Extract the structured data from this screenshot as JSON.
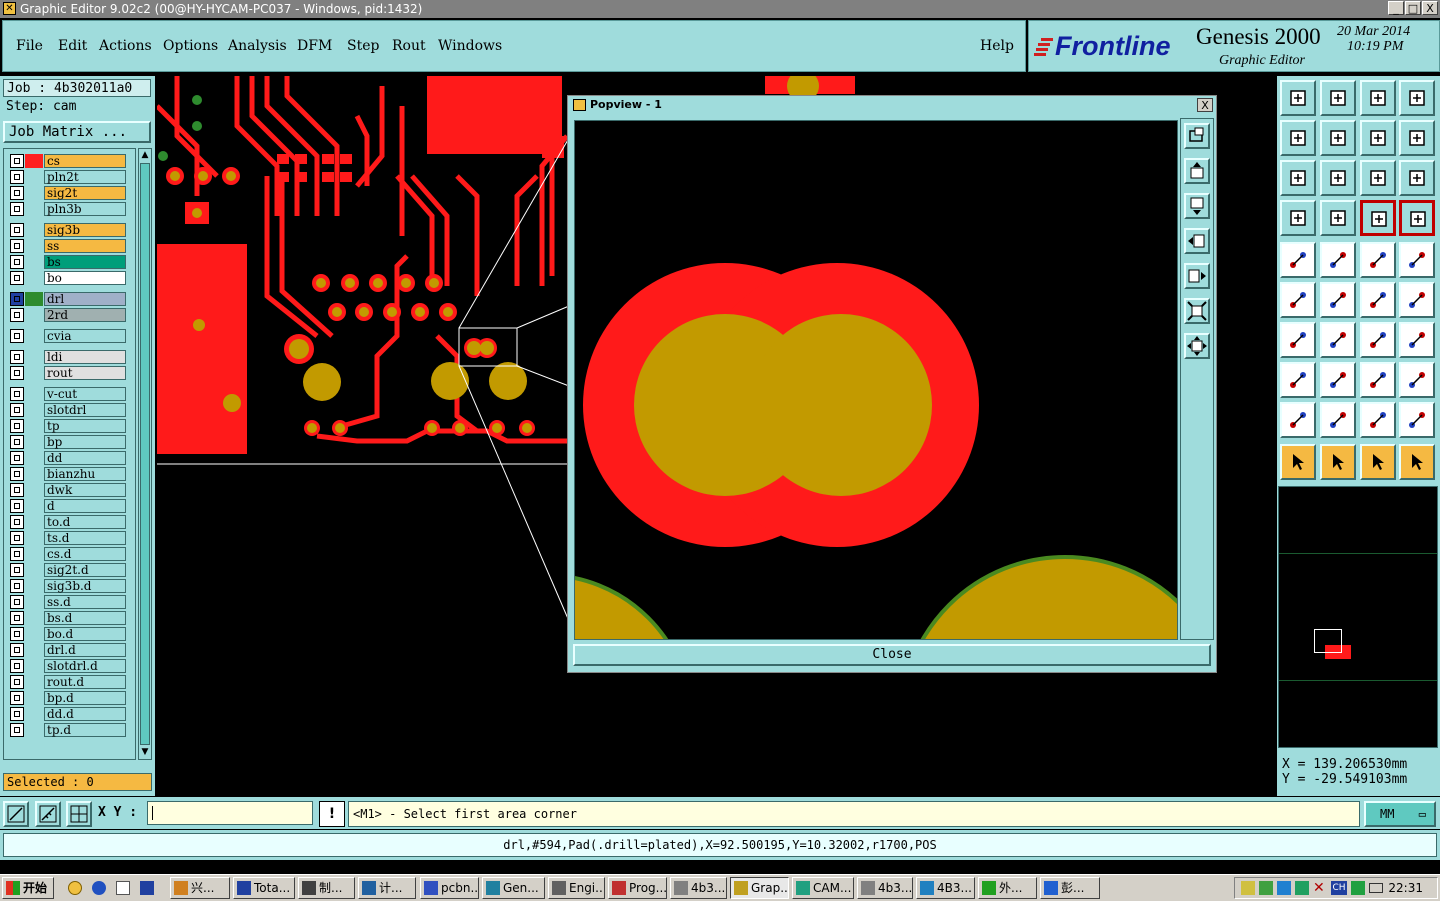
{
  "window": {
    "title": "Graphic Editor 9.02c2 (00@HY-HYCAM-PC037 - Windows, pid:1432)",
    "buttons": [
      "_",
      "□",
      "X"
    ]
  },
  "menu": {
    "items": [
      "File",
      "Edit",
      "Actions",
      "Options",
      "Analysis",
      "DFM",
      "Step",
      "Rout",
      "Windows"
    ],
    "help": "Help"
  },
  "brand": {
    "logo": "Frontline",
    "product": "Genesis 2000",
    "subtitle": "Graphic Editor",
    "date": "20 Mar 2014",
    "time": "10:19 PM"
  },
  "job": {
    "job_label": "Job : 4b302011a0",
    "step_label": "Step: cam",
    "matrix_button": "Job Matrix ..."
  },
  "layers": [
    {
      "name": "cs",
      "color": "#ff2020",
      "bg": "#f5b942",
      "gap": 0
    },
    {
      "name": "pln2t",
      "color": "",
      "bg": "#9fdcdc",
      "gap": 0
    },
    {
      "name": "sig2t",
      "color": "",
      "bg": "#f5b942",
      "gap": 0
    },
    {
      "name": "pln3b",
      "color": "",
      "bg": "#9fdcdc",
      "gap": 0
    },
    {
      "name": "sig3b",
      "color": "",
      "bg": "#f5b942",
      "gap": 1
    },
    {
      "name": "ss",
      "color": "",
      "bg": "#f5b942",
      "gap": 0
    },
    {
      "name": "bs",
      "color": "",
      "bg": "#009e7a",
      "gap": 0
    },
    {
      "name": "bo",
      "color": "",
      "bg": "#ffffff",
      "gap": 0,
      "mark": "✎"
    },
    {
      "name": "drl",
      "color": "#2e8b2e",
      "bg": "#a0b0c8",
      "gap": 1,
      "mark": "▦",
      "check_bg": "#2040a0"
    },
    {
      "name": "2rd",
      "color": "",
      "bg": "#a0b0b0",
      "gap": 0
    },
    {
      "name": "cvia",
      "color": "",
      "bg": "#9fdcdc",
      "gap": 1
    },
    {
      "name": "ldi",
      "color": "",
      "bg": "#e0e0e0",
      "gap": 1
    },
    {
      "name": "rout",
      "color": "",
      "bg": "#e0e0e0",
      "gap": 0
    },
    {
      "name": "v-cut",
      "color": "",
      "bg": "#9fdcdc",
      "gap": 1
    },
    {
      "name": "slotdrl",
      "color": "",
      "bg": "#9fdcdc",
      "gap": 0
    },
    {
      "name": "tp",
      "color": "",
      "bg": "#9fdcdc",
      "gap": 0
    },
    {
      "name": "bp",
      "color": "",
      "bg": "#9fdcdc",
      "gap": 0
    },
    {
      "name": "dd",
      "color": "",
      "bg": "#9fdcdc",
      "gap": 0
    },
    {
      "name": "bianzhu",
      "color": "",
      "bg": "#9fdcdc",
      "gap": 0
    },
    {
      "name": "dwk",
      "color": "",
      "bg": "#9fdcdc",
      "gap": 0
    },
    {
      "name": "d",
      "color": "",
      "bg": "#9fdcdc",
      "gap": 0
    },
    {
      "name": "to.d",
      "color": "",
      "bg": "#9fdcdc",
      "gap": 0,
      "mark": "✎"
    },
    {
      "name": "ts.d",
      "color": "",
      "bg": "#9fdcdc",
      "gap": 0
    },
    {
      "name": "cs.d",
      "color": "",
      "bg": "#9fdcdc",
      "gap": 0
    },
    {
      "name": "sig2t.d",
      "color": "",
      "bg": "#9fdcdc",
      "gap": 0
    },
    {
      "name": "sig3b.d",
      "color": "",
      "bg": "#9fdcdc",
      "gap": 0
    },
    {
      "name": "ss.d",
      "color": "",
      "bg": "#9fdcdc",
      "gap": 0
    },
    {
      "name": "bs.d",
      "color": "",
      "bg": "#9fdcdc",
      "gap": 0
    },
    {
      "name": "bo.d",
      "color": "",
      "bg": "#9fdcdc",
      "gap": 0,
      "mark": "✎"
    },
    {
      "name": "drl.d",
      "color": "",
      "bg": "#9fdcdc",
      "gap": 0
    },
    {
      "name": "slotdrl.d",
      "color": "",
      "bg": "#9fdcdc",
      "gap": 0
    },
    {
      "name": "rout.d",
      "color": "",
      "bg": "#9fdcdc",
      "gap": 0
    },
    {
      "name": "bp.d",
      "color": "",
      "bg": "#9fdcdc",
      "gap": 0
    },
    {
      "name": "dd.d",
      "color": "",
      "bg": "#9fdcdc",
      "gap": 0
    },
    {
      "name": "tp.d",
      "color": "",
      "bg": "#9fdcdc",
      "gap": 0
    }
  ],
  "selected": "Selected : 0",
  "popview": {
    "title": "Popview - 1",
    "close_x": "X",
    "close_button": "Close"
  },
  "coords": {
    "x": "X  =  139.206530mm",
    "y": "Y  = -29.549103mm"
  },
  "bottom": {
    "xy_label": "X Y :",
    "xy_value": "",
    "excl": "!",
    "prompt": "<M1> - Select first area corner",
    "units": "MM",
    "units_arrow": "▭"
  },
  "status_line": "drl,#594,Pad(.drill=plated),X=92.500195,Y=10.32002,r1700,POS",
  "taskbar": {
    "start": "开始",
    "tasks": [
      "兴...",
      "Tota...",
      "制...",
      "计...",
      "pcbn...",
      "Gen...",
      "Engi...",
      "Prog...",
      "4b3...",
      "Grap...",
      "CAM...",
      "4b3...",
      "4B3...",
      "外...",
      "彭..."
    ],
    "active_task": "Grap...",
    "clock": "22:31"
  },
  "colors": {
    "panel": "#9fdcdc",
    "copper": "#ff1a1a",
    "drill": "#c29a00",
    "highlight": "#f5b942"
  }
}
